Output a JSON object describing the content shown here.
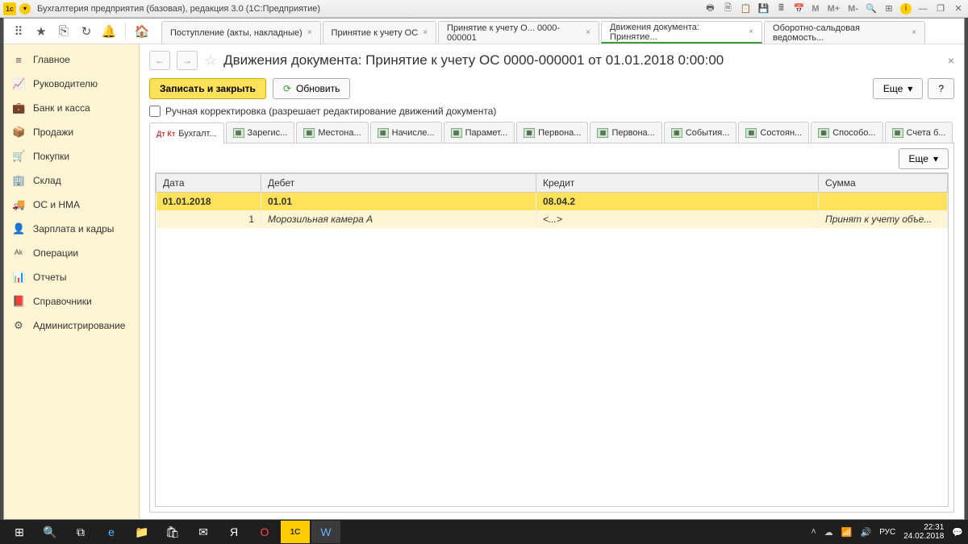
{
  "window": {
    "title": "Бухгалтерия предприятия (базовая), редакция 3.0  (1С:Предприятие)",
    "logo_text": "1c"
  },
  "title_icons": {
    "m1": "M",
    "m2": "M+",
    "m3": "M-"
  },
  "top_tabs": [
    {
      "label": "Поступление (акты, накладные)",
      "closable": true
    },
    {
      "label": "Принятие к учету ОС",
      "closable": true
    },
    {
      "label": "Принятие к учету О... 0000-000001",
      "closable": true
    },
    {
      "label": "Движения документа: Принятие...",
      "closable": true,
      "active": true
    },
    {
      "label": "Оборотно-сальдовая ведомость...",
      "closable": true
    }
  ],
  "sidebar": {
    "items": [
      {
        "icon": "≡",
        "label": "Главное"
      },
      {
        "icon": "📈",
        "label": "Руководителю"
      },
      {
        "icon": "💼",
        "label": "Банк и касса"
      },
      {
        "icon": "📦",
        "label": "Продажи"
      },
      {
        "icon": "🛒",
        "label": "Покупки"
      },
      {
        "icon": "🏢",
        "label": "Склад"
      },
      {
        "icon": "🚚",
        "label": "ОС и НМА"
      },
      {
        "icon": "👤",
        "label": "Зарплата и кадры"
      },
      {
        "icon": "ᴬᵏ",
        "label": "Операции"
      },
      {
        "icon": "📊",
        "label": "Отчеты"
      },
      {
        "icon": "📕",
        "label": "Справочники"
      },
      {
        "icon": "⚙",
        "label": "Администрирование"
      }
    ]
  },
  "page": {
    "title": "Движения документа: Принятие к учету ОС 0000-000001 от 01.01.2018 0:00:00",
    "save_close": "Записать и закрыть",
    "refresh": "Обновить",
    "more": "Еще",
    "help": "?",
    "manual_edit": "Ручная корректировка (разрешает редактирование движений документа)"
  },
  "subtabs": [
    {
      "label": "Бухгалт...",
      "active": true,
      "dtkt": true
    },
    {
      "label": "Зарегис..."
    },
    {
      "label": "Местона..."
    },
    {
      "label": "Начисле..."
    },
    {
      "label": "Парамет..."
    },
    {
      "label": "Первона..."
    },
    {
      "label": "Первона..."
    },
    {
      "label": "События..."
    },
    {
      "label": "Состоян..."
    },
    {
      "label": "Способо..."
    },
    {
      "label": "Счета б..."
    }
  ],
  "grid": {
    "more": "Еще",
    "headers": {
      "date": "Дата",
      "debit": "Дебет",
      "credit": "Кредит",
      "sum": "Сумма"
    },
    "rows": [
      {
        "date": "01.01.2018",
        "debit": "01.01",
        "credit": "08.04.2",
        "sum": "",
        "hl": 1
      },
      {
        "date": "1",
        "debit": "Морозильная камера A",
        "credit": "<...>",
        "sum": "Принят к учету объе...",
        "hl": 2
      }
    ]
  },
  "statusbar": {
    "lang": "РУС",
    "time": "22:31",
    "date": "24.02.2018"
  }
}
